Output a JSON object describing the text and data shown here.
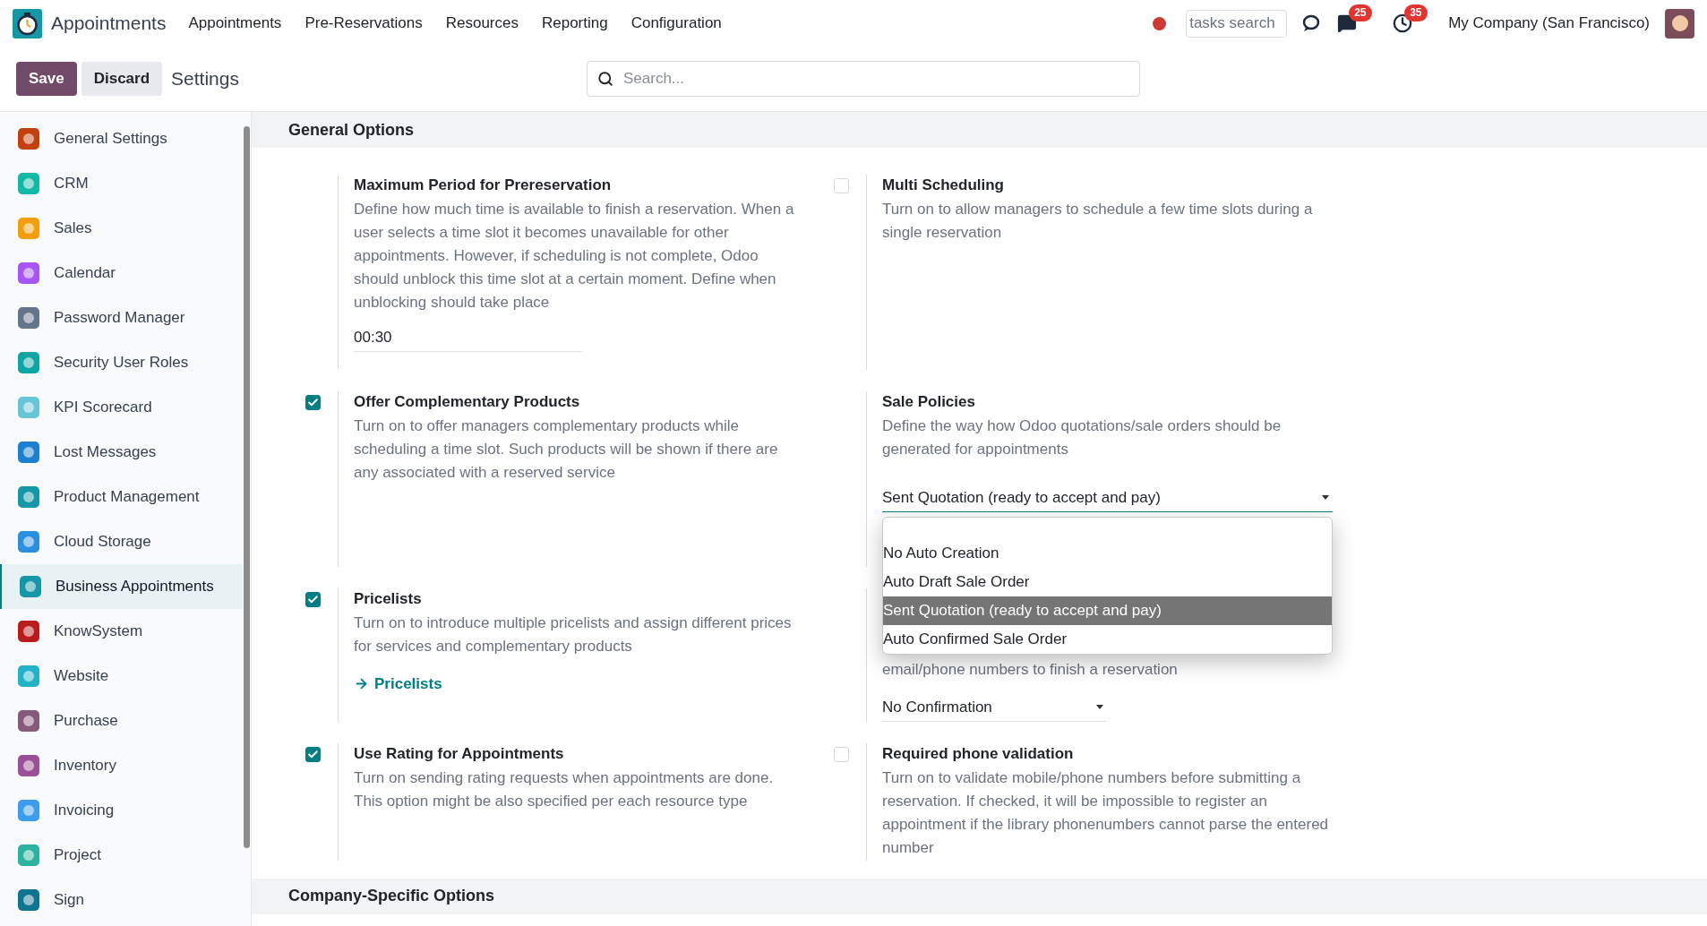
{
  "navbar": {
    "app_name": "Appointments",
    "menu": [
      "Appointments",
      "Pre-Reservations",
      "Resources",
      "Reporting",
      "Configuration"
    ],
    "tasks_search": {
      "placeholder": "tasks search"
    },
    "messages_badge": "25",
    "activities_badge": "35",
    "company": "My Company (San Francisco)"
  },
  "control_panel": {
    "save": "Save",
    "discard": "Discard",
    "breadcrumb": "Settings",
    "search": {
      "placeholder": "Search..."
    }
  },
  "sidebar": {
    "items": [
      {
        "label": "General Settings",
        "selected": false
      },
      {
        "label": "CRM",
        "selected": false
      },
      {
        "label": "Sales",
        "selected": false
      },
      {
        "label": "Calendar",
        "selected": false
      },
      {
        "label": "Password Manager",
        "selected": false
      },
      {
        "label": "Security User Roles",
        "selected": false
      },
      {
        "label": "KPI Scorecard",
        "selected": false
      },
      {
        "label": "Lost Messages",
        "selected": false
      },
      {
        "label": "Product Management",
        "selected": false
      },
      {
        "label": "Cloud Storage",
        "selected": false
      },
      {
        "label": "Business Appointments",
        "selected": true
      },
      {
        "label": "KnowSystem",
        "selected": false
      },
      {
        "label": "Website",
        "selected": false
      },
      {
        "label": "Purchase",
        "selected": false
      },
      {
        "label": "Inventory",
        "selected": false
      },
      {
        "label": "Invoicing",
        "selected": false
      },
      {
        "label": "Project",
        "selected": false
      },
      {
        "label": "Sign",
        "selected": false
      }
    ]
  },
  "sections": [
    {
      "title": "General Options",
      "rows": [
        [
          {
            "kind": "field",
            "title": "Maximum Period for Prereservation",
            "description": "Define how much time is available to finish a reservation. When a user selects a time slot it becomes unavailable for other appointments. However, if scheduling is not complete, Odoo should unblock this time slot at a certain moment. Define when unblocking should take place",
            "value": "00:30"
          },
          {
            "kind": "checkbox",
            "checked": false,
            "title": "Multi Scheduling",
            "description": "Turn on to allow managers to schedule a few time slots during a single reservation"
          }
        ],
        [
          {
            "kind": "checkbox",
            "checked": true,
            "title": "Offer Complementary Products",
            "description": "Turn on to offer managers complementary products while scheduling a time slot. Such products will be shown if there are any associated with a reserved service"
          },
          {
            "kind": "select",
            "title": "Sale Policies",
            "description": "Define the way how Odoo quotations/sale orders should be generated for appointments",
            "value": "Sent Quotation (ready to accept and pay)",
            "open": true,
            "options": [
              {
                "label": "No Auto Creation",
                "selected": false
              },
              {
                "label": "Auto Draft Sale Order",
                "selected": false
              },
              {
                "label": "Sent Quotation (ready to accept and pay)",
                "selected": true
              },
              {
                "label": "Auto Confirmed Sale Order",
                "selected": false
              }
            ]
          }
        ],
        [
          {
            "kind": "checkbox",
            "checked": true,
            "title": "Pricelists",
            "description": "Turn on to introduce multiple pricelists and assign different prices for services and complementary products",
            "link": "Pricelists"
          },
          {
            "kind": "select",
            "description": "email/phone numbers to finish a reservation",
            "value": "No Confirmation",
            "open": false
          }
        ],
        [
          {
            "kind": "checkbox",
            "checked": true,
            "title": "Use Rating for Appointments",
            "description": "Turn on sending rating requests when appointments are done. This option might be also specified per each resource type"
          },
          {
            "kind": "checkbox",
            "checked": false,
            "title": "Required phone validation",
            "description": "Turn on to validate mobile/phone numbers before submitting a reservation. If checked, it will be impossible to register an appointment if the library phonenumbers cannot parse the entered number"
          }
        ]
      ]
    },
    {
      "title": "Company-Specific Options"
    }
  ]
}
